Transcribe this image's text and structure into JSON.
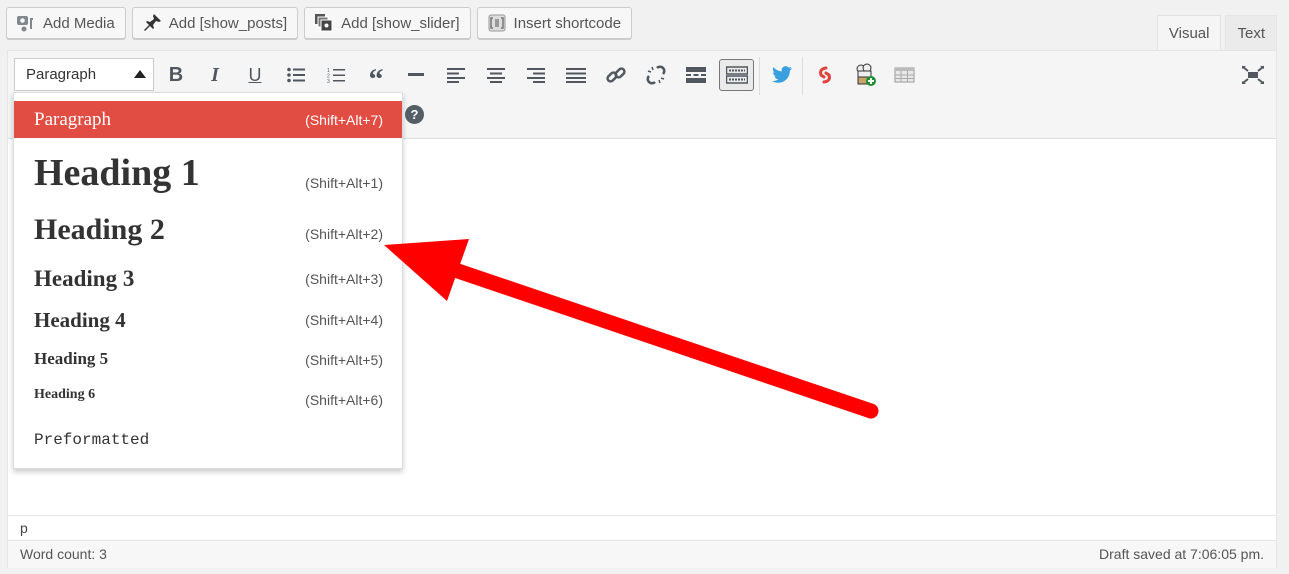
{
  "media_buttons": [
    {
      "label": "Add Media",
      "icon": "add-media-icon"
    },
    {
      "label": "Add [show_posts]",
      "icon": "pushpin-icon"
    },
    {
      "label": "Add [show_slider]",
      "icon": "slider-icon"
    },
    {
      "label": "Insert shortcode",
      "icon": "shortcode-icon"
    }
  ],
  "tabs": [
    {
      "label": "Visual",
      "active": true
    },
    {
      "label": "Text",
      "active": false
    }
  ],
  "toolbar": {
    "format_select": "Paragraph",
    "buttons": [
      "bold",
      "italic",
      "underline",
      "bulleted-list",
      "numbered-list",
      "blockquote",
      "horizontal-line",
      "align-left",
      "align-center",
      "align-right",
      "justify",
      "insert-link",
      "remove-link",
      "read-more",
      "toolbar-toggle",
      "twitter",
      "sumome",
      "chef-add",
      "table"
    ],
    "help_label": "?"
  },
  "format_menu": {
    "items": [
      {
        "label": "Paragraph",
        "shortcut": "(Shift+Alt+7)",
        "selected": true
      },
      {
        "label": "Heading 1",
        "shortcut": "(Shift+Alt+1)"
      },
      {
        "label": "Heading 2",
        "shortcut": "(Shift+Alt+2)"
      },
      {
        "label": "Heading 3",
        "shortcut": "(Shift+Alt+3)"
      },
      {
        "label": "Heading 4",
        "shortcut": "(Shift+Alt+4)"
      },
      {
        "label": "Heading 5",
        "shortcut": "(Shift+Alt+5)"
      },
      {
        "label": "Heading 6",
        "shortcut": "(Shift+Alt+6)"
      },
      {
        "label": "Preformatted",
        "shortcut": ""
      }
    ]
  },
  "path": "p",
  "status": {
    "word_count": "Word count: 3",
    "draft_saved": "Draft saved at 7:06:05 pm."
  },
  "colors": {
    "accent": "#e14d43",
    "annotation_arrow": "#ff0000",
    "twitter": "#3a9fdf"
  }
}
